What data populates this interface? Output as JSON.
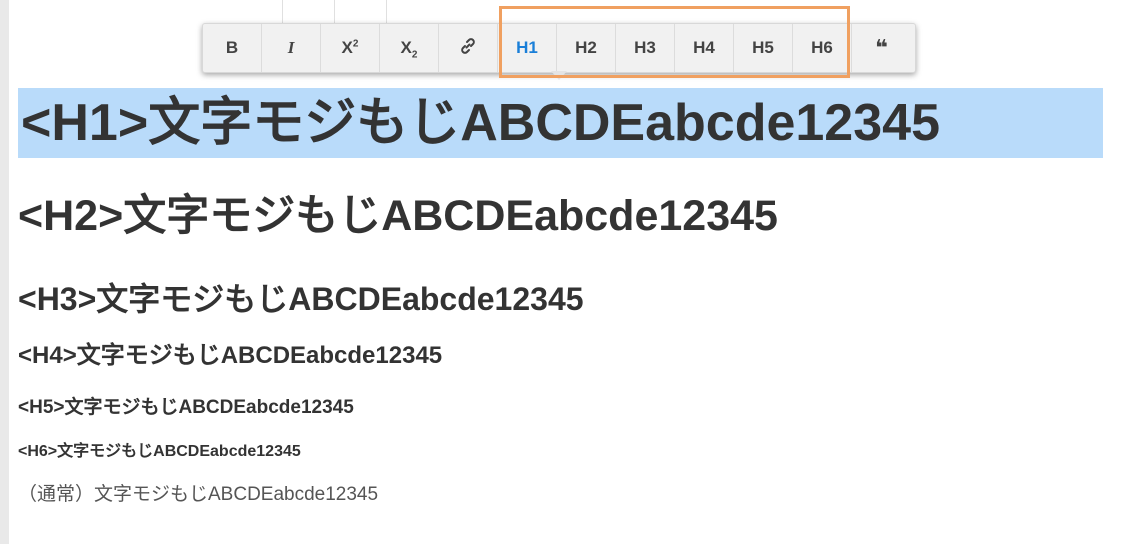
{
  "toolbar": {
    "bold": "B",
    "italic": "I",
    "superscript_base": "X",
    "superscript_mark": "2",
    "subscript_base": "X",
    "subscript_mark": "2",
    "link_icon": "link-icon",
    "h1": "H1",
    "h2": "H2",
    "h3": "H3",
    "h4": "H4",
    "h5": "H5",
    "h6": "H6",
    "quote": "❝",
    "active_heading": "H1",
    "active_color": "#1a7fd8"
  },
  "content": {
    "h1": "<H1>文字モジもじABCDEabcde12345",
    "h2": "<H2>文字モジもじABCDEabcde12345",
    "h3": "<H3>文字モジもじABCDEabcde12345",
    "h4": "<H4>文字モジもじABCDEabcde12345",
    "h5": "<H5>文字モジもじABCDEabcde12345",
    "h6": "<H6>文字モジもじABCDEabcde12345",
    "normal": "（通常）文字モジもじABCDEabcde12345"
  },
  "colors": {
    "selection": "#b9dbfa",
    "highlight_box": "#f0a060",
    "text": "#333333"
  }
}
